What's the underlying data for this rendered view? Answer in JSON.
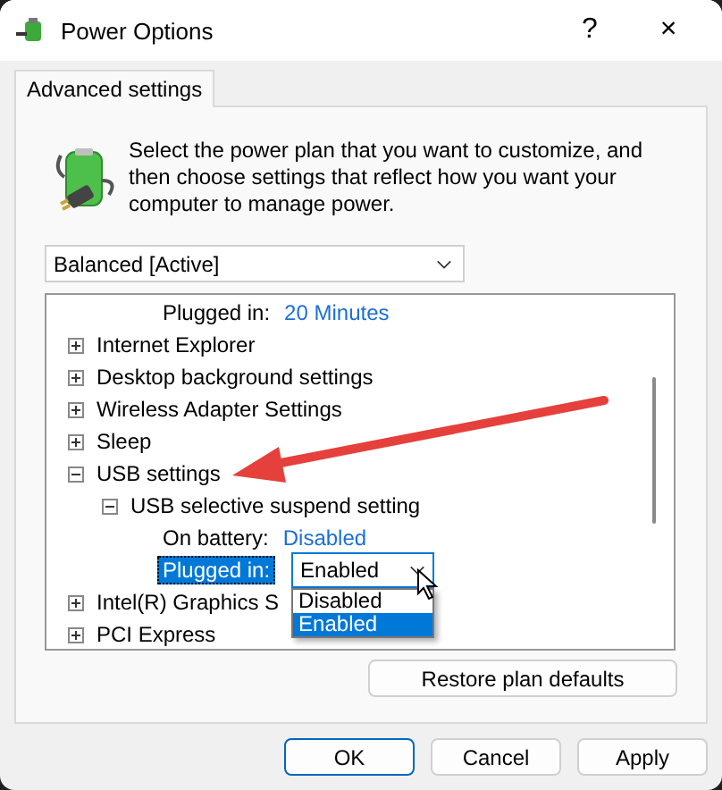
{
  "window": {
    "title": "Power Options",
    "help": "?",
    "close": "×"
  },
  "tabs": [
    {
      "label": "Advanced settings",
      "selected": true
    }
  ],
  "intro": "Select the power plan that you want to customize, and then choose settings that reflect how you want your computer to manage power.",
  "plan": {
    "value": "Balanced [Active]"
  },
  "tree": [
    {
      "kind": "setting",
      "label": "Plugged in:",
      "value": "20 Minutes",
      "selected": false
    },
    {
      "kind": "group",
      "label": "Internet Explorer",
      "expanded": false
    },
    {
      "kind": "group",
      "label": "Desktop background settings",
      "expanded": false
    },
    {
      "kind": "group",
      "label": "Wireless Adapter Settings",
      "expanded": false
    },
    {
      "kind": "group",
      "label": "Sleep",
      "expanded": false
    },
    {
      "kind": "group",
      "label": "USB settings",
      "expanded": true,
      "children": [
        {
          "kind": "group",
          "label": "USB selective suspend setting",
          "expanded": true,
          "children": [
            {
              "kind": "setting",
              "label": "On battery:",
              "value": "Disabled",
              "selected": false
            },
            {
              "kind": "setting",
              "label": "Plugged in:",
              "selected": true,
              "dropdown": {
                "value": "Enabled",
                "open": true,
                "options": [
                  {
                    "label": "Disabled",
                    "selected": false
                  },
                  {
                    "label": "Enabled",
                    "selected": true
                  }
                ]
              }
            }
          ]
        }
      ]
    },
    {
      "kind": "group",
      "label": "Intel(R) Graphics S",
      "expanded": false
    },
    {
      "kind": "group",
      "label": "PCI Express",
      "expanded": false
    }
  ],
  "restore_button": "Restore plan defaults",
  "buttons": [
    {
      "label": "OK",
      "kind": "default"
    },
    {
      "label": "Cancel",
      "kind": "normal"
    },
    {
      "label": "Apply",
      "kind": "normal"
    }
  ]
}
